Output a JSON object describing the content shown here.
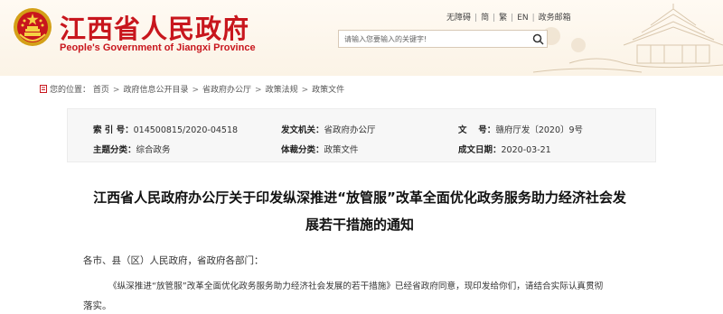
{
  "header": {
    "site_title": "江西省人民政府",
    "site_subtitle": "People's Government of Jiangxi Province",
    "toplinks": [
      "无障碍",
      "简",
      "繁",
      "EN",
      "政务邮箱"
    ],
    "search_placeholder": "请输入您要输入的关键字!"
  },
  "breadcrumb": {
    "label": "您的位置：",
    "items": [
      "首页",
      "政府信息公开目录",
      "省政府办公厅",
      "政策法规",
      "政策文件"
    ]
  },
  "info": {
    "index_label": "索 引 号：",
    "index_value": "014500815/2020-04518",
    "issuer_label": "发文机关：",
    "issuer_value": "省政府办公厅",
    "docno_label": "文　 号：",
    "docno_value": "赣府厅发〔2020〕9号",
    "subject_label": "主题分类：",
    "subject_value": "综合政务",
    "category_label": "体裁分类：",
    "category_value": "政策文件",
    "date_label": "成文日期：",
    "date_value": "2020-03-21"
  },
  "article": {
    "title_line1": "江西省人民政府办公厅关于印发纵深推进“放管服”改革全面优化政务服务助力经济社会发",
    "title_line2": "展若干措施的通知",
    "greeting": "各市、县（区）人民政府，省政府各部门：",
    "body_line1": "《纵深推进“放管服”改革全面优化政务服务助力经济社会发展的若干措施》已经省政府同意，现印发给你们，请结合实际认真贯彻",
    "body_line2": "落实。"
  },
  "colors": {
    "brand_red": "#c8161d",
    "header_bg": "#fbf3e6",
    "info_bg": "#f7f7f7"
  }
}
